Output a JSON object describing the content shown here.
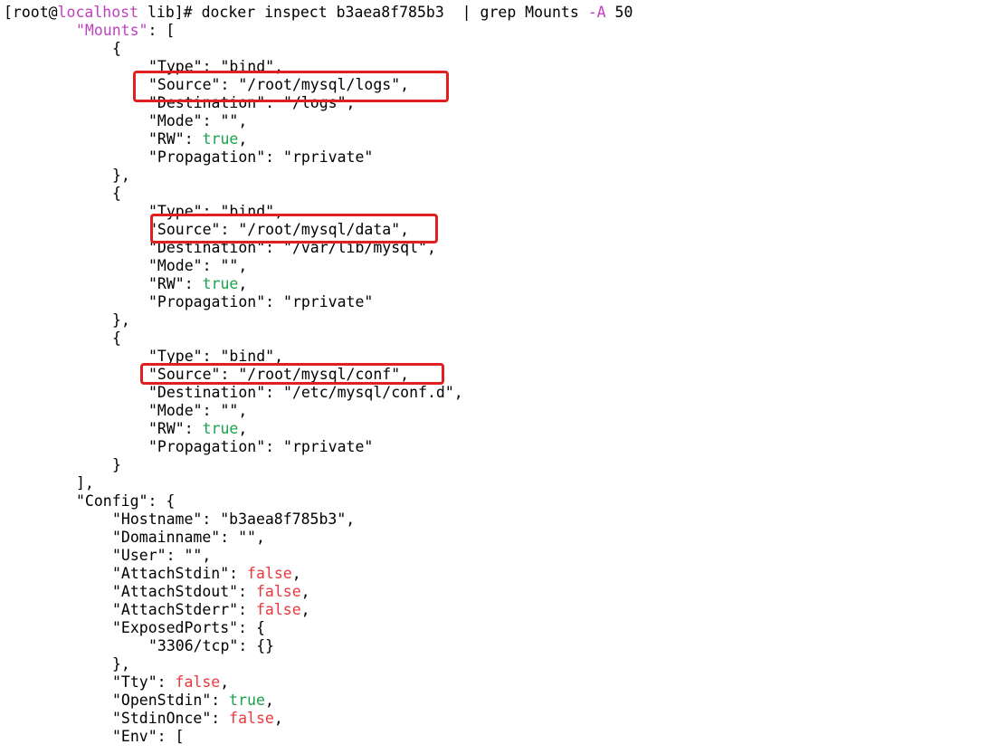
{
  "prompt": {
    "open": "[root@",
    "host": "localhost",
    "rest": " lib]# ",
    "command": "docker inspect b3aea8f785b3  | grep Mounts ",
    "flag": "-A",
    "arg": " 50"
  },
  "colors": {
    "host": "#c040c0",
    "true": "#1aa34a",
    "false": "#e8383d",
    "box": "#e02020"
  },
  "mounts_key": "\"Mounts\"",
  "mounts_open": ": [",
  "mounts": [
    {
      "type": "\"Type\": \"bind\",",
      "source": "\"Source\": \"/root/mysql/logs\",",
      "destination": "\"Destination\": \"/logs\",",
      "mode": "\"Mode\": \"\",",
      "rw_key": "\"RW\": ",
      "rw_val": "true",
      "propagation": "\"Propagation\": \"rprivate\""
    },
    {
      "type": "\"Type\": \"bind\",",
      "source": "\"Source\": \"/root/mysql/data\",",
      "destination": "\"Destination\": \"/var/lib/mysql\",",
      "mode": "\"Mode\": \"\",",
      "rw_key": "\"RW\": ",
      "rw_val": "true",
      "propagation": "\"Propagation\": \"rprivate\""
    },
    {
      "type": "\"Type\": \"bind\",",
      "source": "\"Source\": \"/root/mysql/conf\",",
      "destination": "\"Destination\": \"/etc/mysql/conf.d\",",
      "mode": "\"Mode\": \"\",",
      "rw_key": "\"RW\": ",
      "rw_val": "true",
      "propagation": "\"Propagation\": \"rprivate\""
    }
  ],
  "brace_open": "{",
  "brace_close_comma": "},",
  "brace_close": "}",
  "mounts_close": "],",
  "config": {
    "open": "\"Config\": {",
    "hostname": "\"Hostname\": \"b3aea8f785b3\",",
    "domainname": "\"Domainname\": \"\",",
    "user": "\"User\": \"\",",
    "attach_stdin_key": "\"AttachStdin\": ",
    "attach_stdin_val": "false",
    "attach_stdout_key": "\"AttachStdout\": ",
    "attach_stdout_val": "false",
    "attach_stderr_key": "\"AttachStderr\": ",
    "attach_stderr_val": "false",
    "exposed_ports": "\"ExposedPorts\": {",
    "port": "\"3306/tcp\": {}",
    "exposed_close": "},",
    "tty_key": "\"Tty\": ",
    "tty_val": "false",
    "open_stdin_key": "\"OpenStdin\": ",
    "open_stdin_val": "true",
    "stdin_once_key": "\"StdinOnce\": ",
    "stdin_once_val": "false",
    "env": "\"Env\": ["
  },
  "comma": ","
}
